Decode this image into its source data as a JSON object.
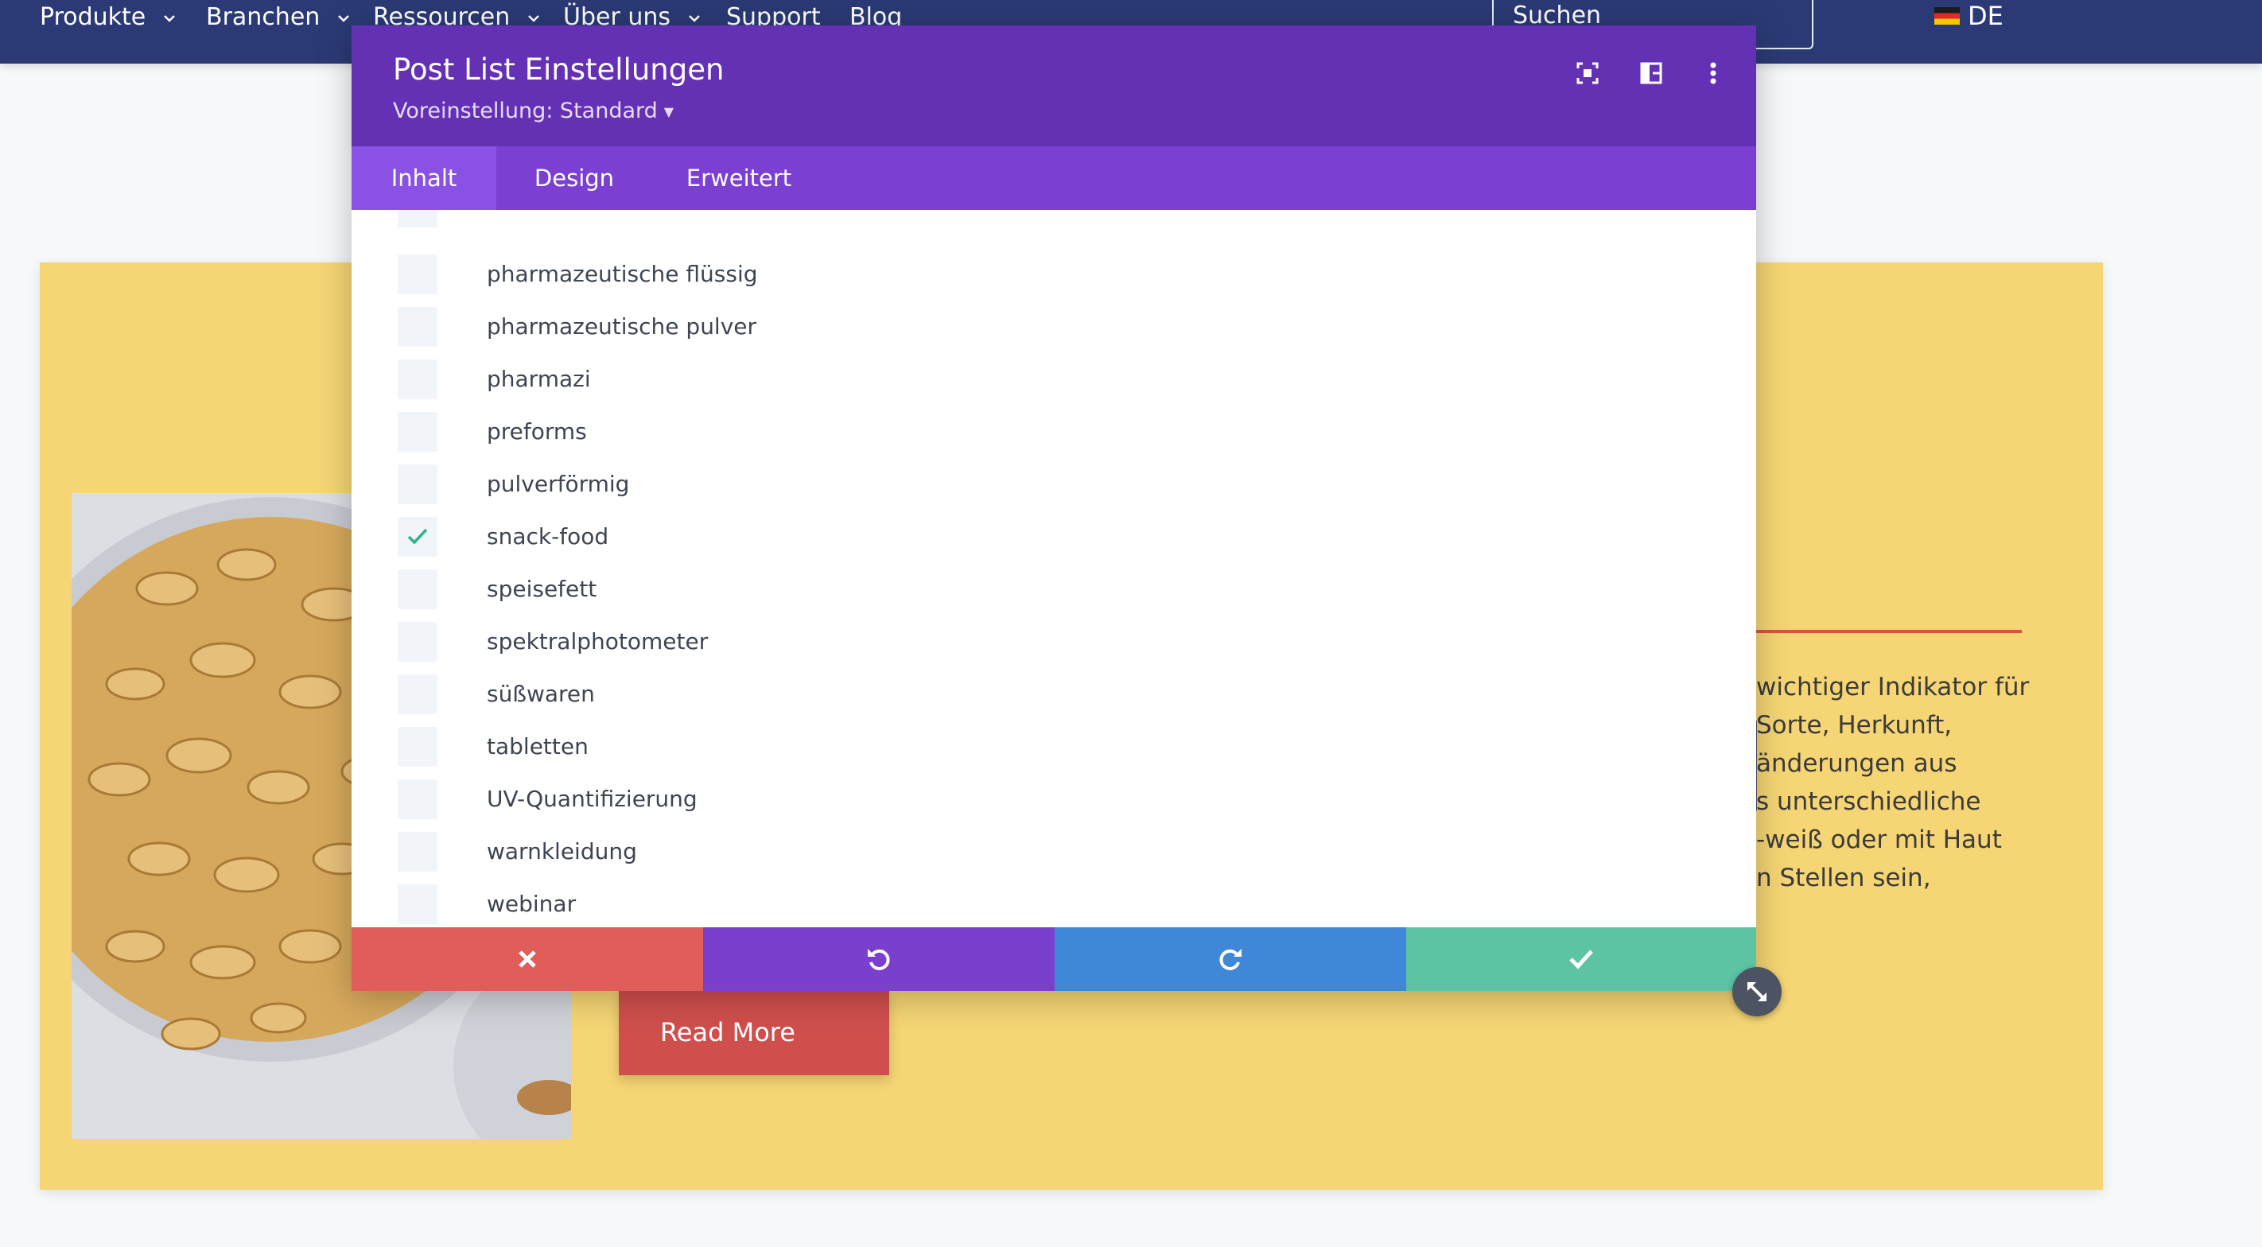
{
  "nav": {
    "items": [
      {
        "label": "Produkte",
        "has_dropdown": true
      },
      {
        "label": "Branchen",
        "has_dropdown": true
      },
      {
        "label": "Ressourcen",
        "has_dropdown": true
      },
      {
        "label": "Über uns",
        "has_dropdown": true
      },
      {
        "label": "Support",
        "has_dropdown": false
      },
      {
        "label": "Blog",
        "has_dropdown": false
      }
    ],
    "search_placeholder": "Suchen",
    "language": "DE"
  },
  "modal": {
    "title": "Post List Einstellungen",
    "preset": "Voreinstellung: Standard",
    "header_icons": [
      "fullscreen-icon",
      "sidebar-layout-icon",
      "more-vertical-icon"
    ],
    "tabs": [
      {
        "label": "Inhalt",
        "active": true
      },
      {
        "label": "Design",
        "active": false
      },
      {
        "label": "Erweitert",
        "active": false
      }
    ],
    "categories": [
      {
        "label": "pharmazeutische flüssig",
        "checked": false
      },
      {
        "label": "pharmazeutische pulver",
        "checked": false
      },
      {
        "label": "pharmazi",
        "checked": false
      },
      {
        "label": "preforms",
        "checked": false
      },
      {
        "label": "pulverförmig",
        "checked": false
      },
      {
        "label": "snack-food",
        "checked": true
      },
      {
        "label": "speisefett",
        "checked": false
      },
      {
        "label": "spektralphotometer",
        "checked": false
      },
      {
        "label": "süßwaren",
        "checked": false
      },
      {
        "label": "tabletten",
        "checked": false
      },
      {
        "label": "UV-Quantifizierung",
        "checked": false
      },
      {
        "label": "warnkleidung",
        "checked": false
      },
      {
        "label": "webinar",
        "checked": false
      }
    ],
    "footer_buttons": [
      {
        "name": "discard",
        "icon": "close-icon",
        "color": "#e05d59"
      },
      {
        "name": "undo",
        "icon": "undo-icon",
        "color": "#7a3fcc"
      },
      {
        "name": "redo",
        "icon": "redo-icon",
        "color": "#4187d8"
      },
      {
        "name": "save",
        "icon": "check-icon",
        "color": "#5cc3a3"
      }
    ]
  },
  "background": {
    "text_lines": [
      "wichtiger Indikator für",
      "Sorte, Herkunft,",
      "änderungen aus",
      "s unterschiedliche",
      "-weiß oder mit Haut",
      "n Stellen sein,"
    ],
    "read_more_label": "Read More",
    "card_color": "#f5d574",
    "accent_red": "#d9504f"
  }
}
